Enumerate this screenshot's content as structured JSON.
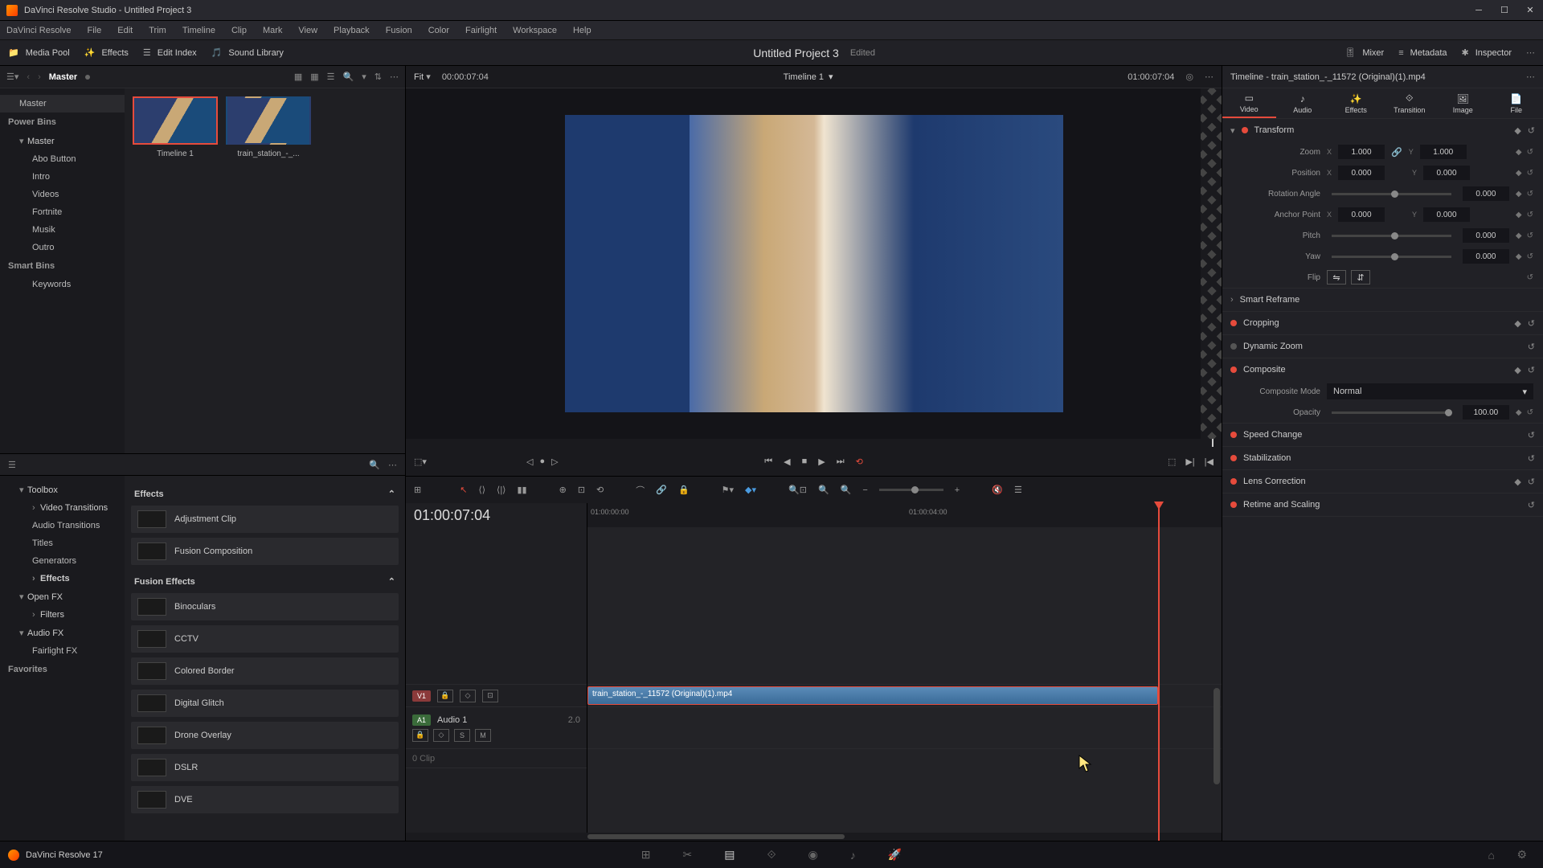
{
  "titlebar": {
    "app": "DaVinci Resolve Studio",
    "project": "Untitled Project 3"
  },
  "menubar": [
    "DaVinci Resolve",
    "File",
    "Edit",
    "Trim",
    "Timeline",
    "Clip",
    "Mark",
    "View",
    "Playback",
    "Fusion",
    "Color",
    "Fairlight",
    "Workspace",
    "Help"
  ],
  "toolbar": {
    "left": {
      "media_pool": "Media Pool",
      "effects": "Effects",
      "edit_index": "Edit Index",
      "sound_library": "Sound Library"
    },
    "center": {
      "title": "Untitled Project 3",
      "status": "Edited"
    },
    "right": {
      "mixer": "Mixer",
      "metadata": "Metadata",
      "inspector": "Inspector"
    }
  },
  "media": {
    "bin": "Master",
    "tree_sections": {
      "power_bins": "Power Bins",
      "smart_bins": "Smart Bins",
      "favorites": "Favorites"
    },
    "tree_root": "Master",
    "tree_items": [
      "Abo Button",
      "Intro",
      "Videos",
      "Fortnite",
      "Musik",
      "Outro"
    ],
    "smart_items": [
      "Keywords"
    ],
    "thumbs": [
      {
        "label": "Timeline 1"
      },
      {
        "label": "train_station_-_..."
      }
    ]
  },
  "effects_tree": {
    "toolbox": "Toolbox",
    "toolbox_items": [
      "Video Transitions",
      "Audio Transitions",
      "Titles",
      "Generators",
      "Effects"
    ],
    "openfx": "Open FX",
    "filters": "Filters",
    "audiofx": "Audio FX",
    "fairlight": "Fairlight FX"
  },
  "effects_list": {
    "sec1": "Effects",
    "items1": [
      "Adjustment Clip",
      "Fusion Composition"
    ],
    "sec2": "Fusion Effects",
    "items2": [
      "Binoculars",
      "CCTV",
      "Colored Border",
      "Digital Glitch",
      "Drone Overlay",
      "DSLR",
      "DVE"
    ]
  },
  "viewer": {
    "fit": "Fit",
    "tc_left": "00:00:07:04",
    "timeline": "Timeline 1",
    "tc_right": "01:00:07:04"
  },
  "timeline": {
    "tc": "01:00:07:04",
    "ruler": [
      "01:00:00:00",
      "01:00:04:00"
    ],
    "v1": "V1",
    "a1": "A1",
    "audio_name": "Audio 1",
    "audio_ch": "2.0",
    "clip_count": "0 Clip",
    "clip": "train_station_-_11572 (Original)(1).mp4",
    "solo": "S",
    "mute": "M"
  },
  "inspector": {
    "title": "Timeline - train_station_-_11572 (Original)(1).mp4",
    "tabs": [
      "Video",
      "Audio",
      "Effects",
      "Transition",
      "Image",
      "File"
    ],
    "transform": "Transform",
    "zoom": "Zoom",
    "zoom_x": "1.000",
    "zoom_y": "1.000",
    "position": "Position",
    "pos_x": "0.000",
    "pos_y": "0.000",
    "rotation": "Rotation Angle",
    "rot_v": "0.000",
    "anchor": "Anchor Point",
    "anc_x": "0.000",
    "anc_y": "0.000",
    "pitch": "Pitch",
    "pitch_v": "0.000",
    "yaw": "Yaw",
    "yaw_v": "0.000",
    "flip": "Flip",
    "smart_reframe": "Smart Reframe",
    "cropping": "Cropping",
    "dynamic_zoom": "Dynamic Zoom",
    "composite": "Composite",
    "composite_mode": "Composite Mode",
    "composite_val": "Normal",
    "opacity": "Opacity",
    "opacity_v": "100.00",
    "speed": "Speed Change",
    "stabilization": "Stabilization",
    "lens": "Lens Correction",
    "retime": "Retime and Scaling"
  },
  "footer": {
    "version": "DaVinci Resolve 17"
  }
}
